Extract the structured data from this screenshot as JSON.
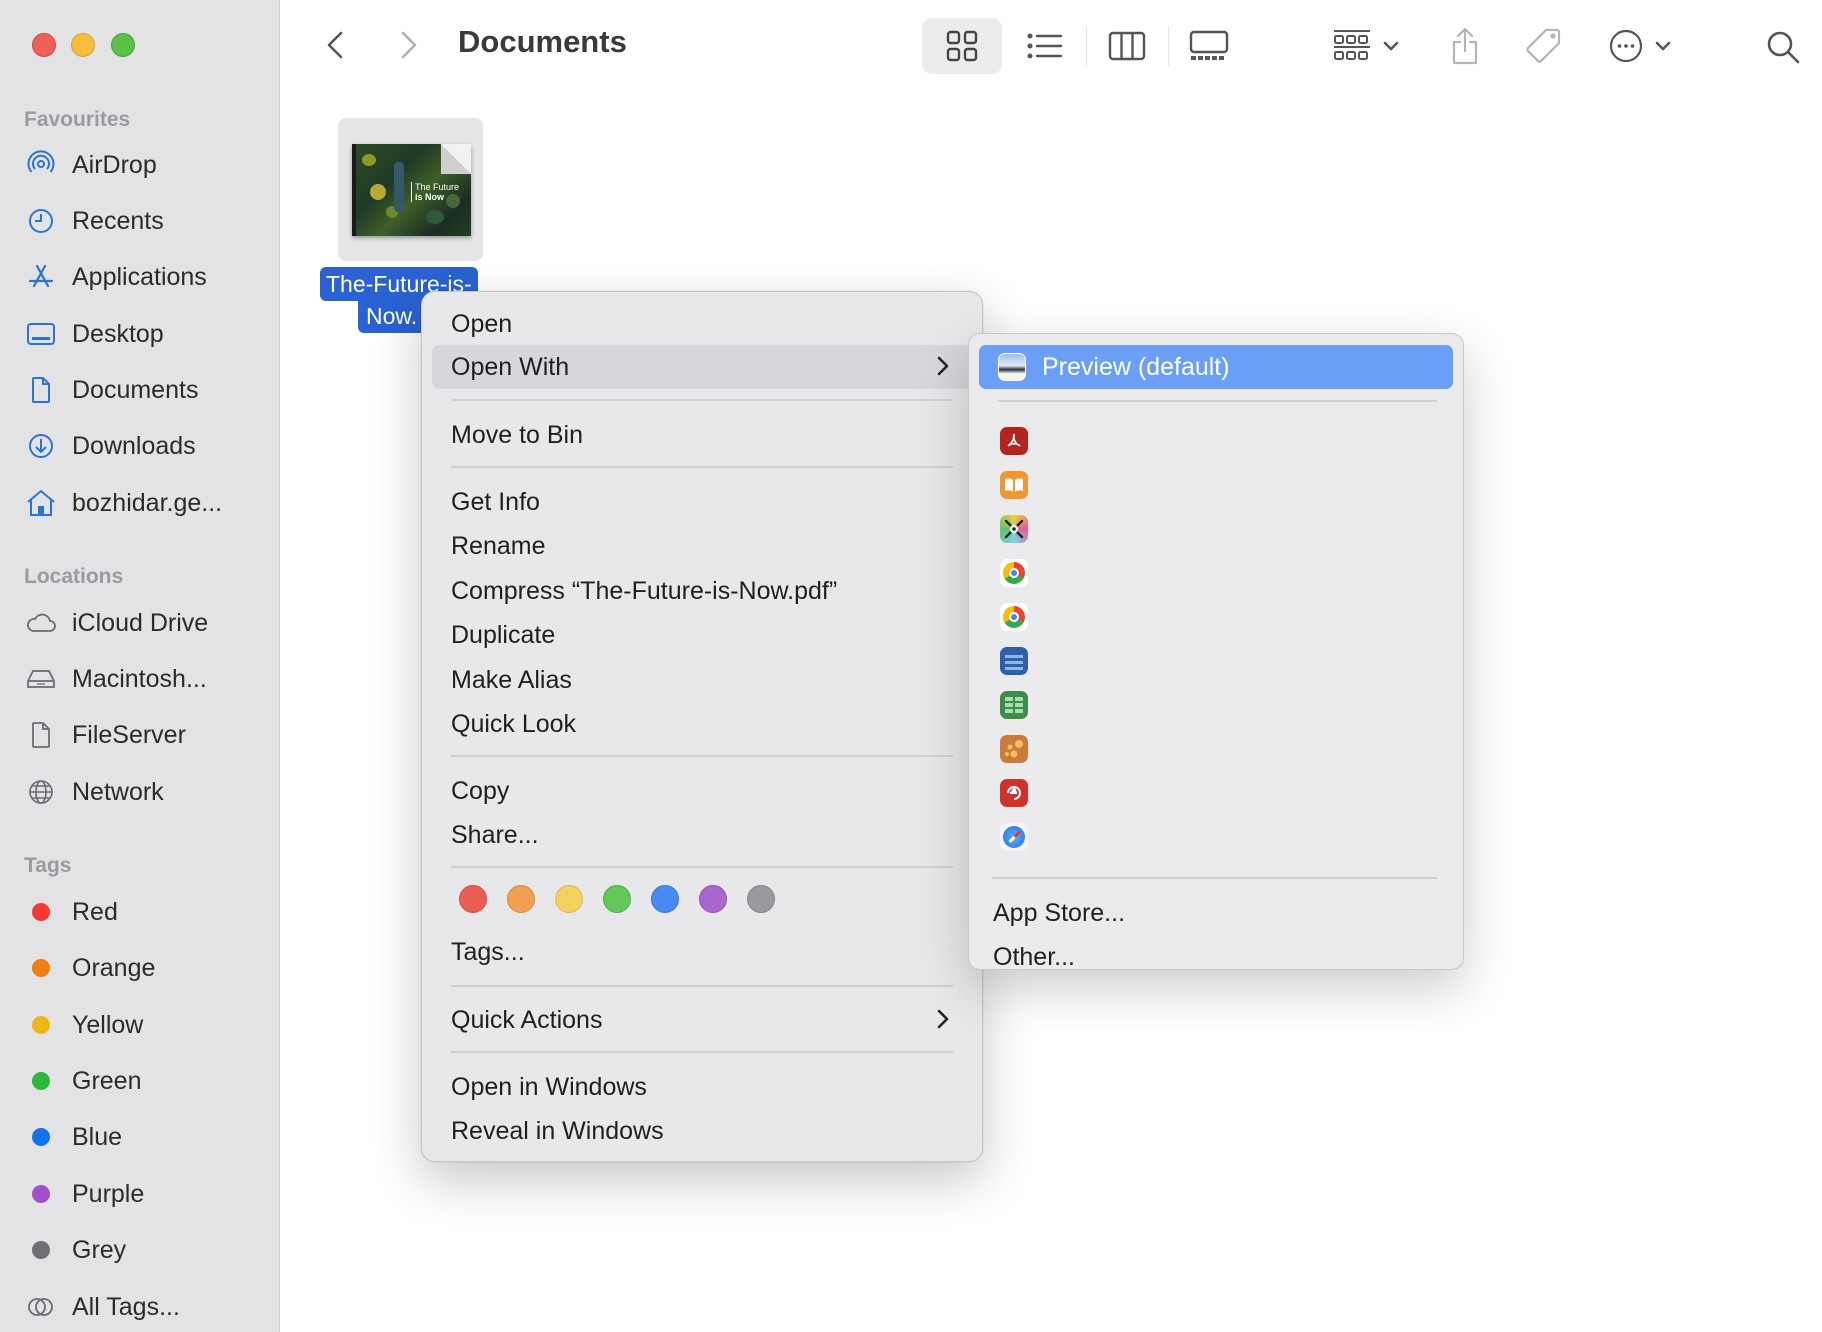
{
  "window": {
    "title": "Documents",
    "traffic_lights": [
      "close",
      "minimize",
      "zoom"
    ]
  },
  "sidebar": {
    "favourites_title": "Favourites",
    "favourites": [
      {
        "label": "AirDrop",
        "icon": "airdrop-icon"
      },
      {
        "label": "Recents",
        "icon": "clock-icon"
      },
      {
        "label": "Applications",
        "icon": "applications-icon"
      },
      {
        "label": "Desktop",
        "icon": "desktop-icon"
      },
      {
        "label": "Documents",
        "icon": "document-icon"
      },
      {
        "label": "Downloads",
        "icon": "download-icon"
      },
      {
        "label": "bozhidar.ge...",
        "icon": "home-icon"
      }
    ],
    "locations_title": "Locations",
    "locations": [
      {
        "label": "iCloud Drive",
        "icon": "cloud-icon"
      },
      {
        "label": "Macintosh...",
        "icon": "disk-icon"
      },
      {
        "label": "FileServer",
        "icon": "document-icon"
      },
      {
        "label": "Network",
        "icon": "globe-icon"
      }
    ],
    "tags_title": "Tags",
    "tags": [
      {
        "label": "Red",
        "color": "#f23a32"
      },
      {
        "label": "Orange",
        "color": "#ef7f11"
      },
      {
        "label": "Yellow",
        "color": "#ecb719"
      },
      {
        "label": "Green",
        "color": "#2bb83c"
      },
      {
        "label": "Blue",
        "color": "#1572ee"
      },
      {
        "label": "Purple",
        "color": "#a34fcb"
      },
      {
        "label": "Grey",
        "color": "#707074"
      },
      {
        "label": "All Tags...",
        "color": null
      }
    ],
    "accent_color": "#2a72d8"
  },
  "toolbar": {
    "back": "back",
    "forward": "forward",
    "views": [
      "icon-view",
      "list-view",
      "column-view",
      "gallery-view"
    ],
    "active_view": "icon-view",
    "group_by": "group",
    "share": "share",
    "tag": "tag",
    "more": "more",
    "search": "search"
  },
  "files": [
    {
      "name_line1": "The-Future-is-",
      "name_line2": "Now.",
      "thumbnail_text_line1": "The Future",
      "thumbnail_text_line2": "is Now",
      "selected": true
    }
  ],
  "context_menu": {
    "items": {
      "open": "Open",
      "open_with": "Open With",
      "move_to_bin": "Move to Bin",
      "get_info": "Get Info",
      "rename": "Rename",
      "compress": "Compress “The-Future-is-Now.pdf”",
      "duplicate": "Duplicate",
      "make_alias": "Make Alias",
      "quick_look": "Quick Look",
      "copy": "Copy",
      "share": "Share...",
      "tags": "Tags...",
      "quick_actions": "Quick Actions",
      "open_in_windows": "Open in Windows",
      "reveal_in_windows": "Reveal in Windows"
    },
    "highlighted": "Open With",
    "tag_colors": [
      "#eb5e54",
      "#f0a050",
      "#f4d060",
      "#62c85a",
      "#4a8af4",
      "#a866d0",
      "#9a9a9e"
    ]
  },
  "open_with_submenu": {
    "default_app": "Preview (default)",
    "apps": [
      {
        "icon": "acrobat-icon",
        "color": "#b2241d"
      },
      {
        "icon": "books-icon",
        "color": "#f0952f"
      },
      {
        "icon": "color-utility-icon",
        "color": "#d96fbb"
      },
      {
        "icon": "chrome-icon",
        "color": "#ffffff"
      },
      {
        "icon": "chrome-icon",
        "color": "#ffffff"
      },
      {
        "icon": "document-app-icon",
        "color": "#2f5fa8"
      },
      {
        "icon": "spreadsheet-app-icon",
        "color": "#3f8a4c"
      },
      {
        "icon": "tiles-app-icon",
        "color": "#c97a3c"
      },
      {
        "icon": "pdf-app-icon",
        "color": "#d0322b"
      },
      {
        "icon": "safari-icon",
        "color": "#3a8ef0"
      }
    ],
    "app_store": "App Store...",
    "other": "Other..."
  }
}
